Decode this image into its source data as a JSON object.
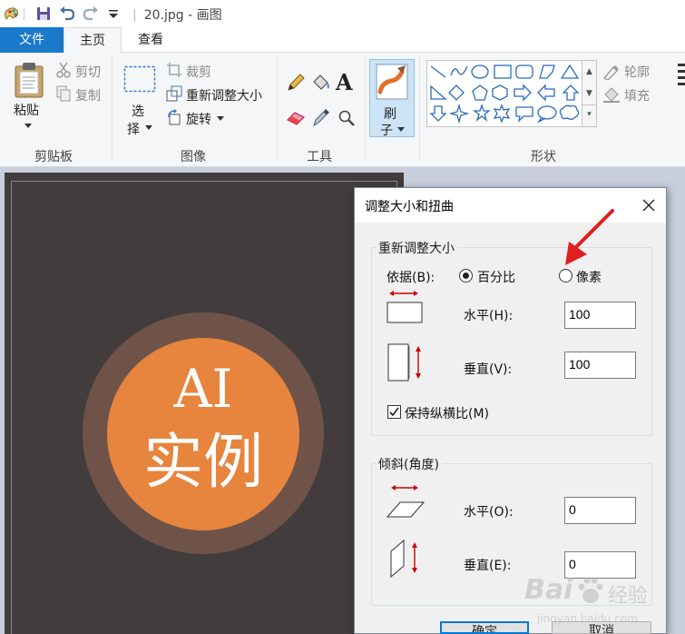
{
  "app": {
    "title": "20.jpg - 画图",
    "title_sep": "|"
  },
  "tabs": {
    "file": "文件",
    "home": "主页",
    "view": "查看"
  },
  "ribbon": {
    "clipboard": {
      "paste": "粘贴",
      "cut": "剪切",
      "copy": "复制",
      "label": "剪贴板"
    },
    "image": {
      "select_top": "选",
      "select_bottom": "择",
      "crop": "裁剪",
      "resize": "重新调整大小",
      "rotate": "旋转",
      "label": "图像"
    },
    "tools": {
      "label": "工具"
    },
    "brushes": {
      "top": "刷",
      "bottom": "子"
    },
    "shapes": {
      "outline": "轮廓",
      "fill": "填充",
      "label": "形状"
    }
  },
  "canvas": {
    "logo_line1": "AI",
    "logo_line2": "实例"
  },
  "dialog": {
    "title": "调整大小和扭曲",
    "resize_section": "重新调整大小",
    "by_label": "依据(B):",
    "option_percent": "百分比",
    "option_pixels": "像素",
    "selected_option": "percent",
    "resize_h_label": "水平(H):",
    "resize_h_value": "100",
    "resize_v_label": "垂直(V):",
    "resize_v_value": "100",
    "keep_ratio_label": "保持纵横比(M)",
    "keep_ratio_checked": true,
    "skew_section": "倾斜(角度)",
    "skew_h_label": "水平(O):",
    "skew_h_value": "0",
    "skew_v_label": "垂直(E):",
    "skew_v_value": "0",
    "ok": "确定",
    "cancel": "取消"
  },
  "watermark": {
    "brand": "Bai",
    "brand2": "经验",
    "url": "jingyan.baidu.com"
  },
  "colors": {
    "accent": "#1979ca",
    "annotation_arrow": "#e02020",
    "image_bg": "#423c3d",
    "logo_ring": "#6f5349",
    "logo_disc": "#e7843d"
  }
}
